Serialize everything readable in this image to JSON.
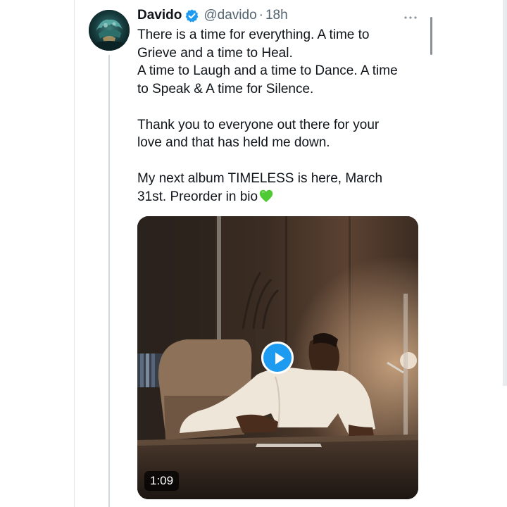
{
  "tweet": {
    "display_name": "Davido",
    "verified": true,
    "handle": "@davido",
    "separator": "·",
    "time": "18h",
    "more_icon": "more-horizontal-icon",
    "text_lines": [
      "There is a time for everything. A time to",
      "Grieve and a time to Heal.",
      "A time to Laugh and a time to Dance. A time",
      "to Speak & A time for Silence.",
      "Thank you to everyone out there for your",
      "love and that has held me down.",
      "My next album TIMELESS is here, March",
      "31st. Preorder in bio"
    ],
    "emoji": "green-heart-icon"
  },
  "media": {
    "type": "video",
    "duration": "1:09",
    "play_icon": "play-icon"
  },
  "colors": {
    "verified_blue": "#1d9bf0",
    "text": "#0f1419",
    "secondary_text": "#536471",
    "thread_line": "#cfd9de"
  }
}
